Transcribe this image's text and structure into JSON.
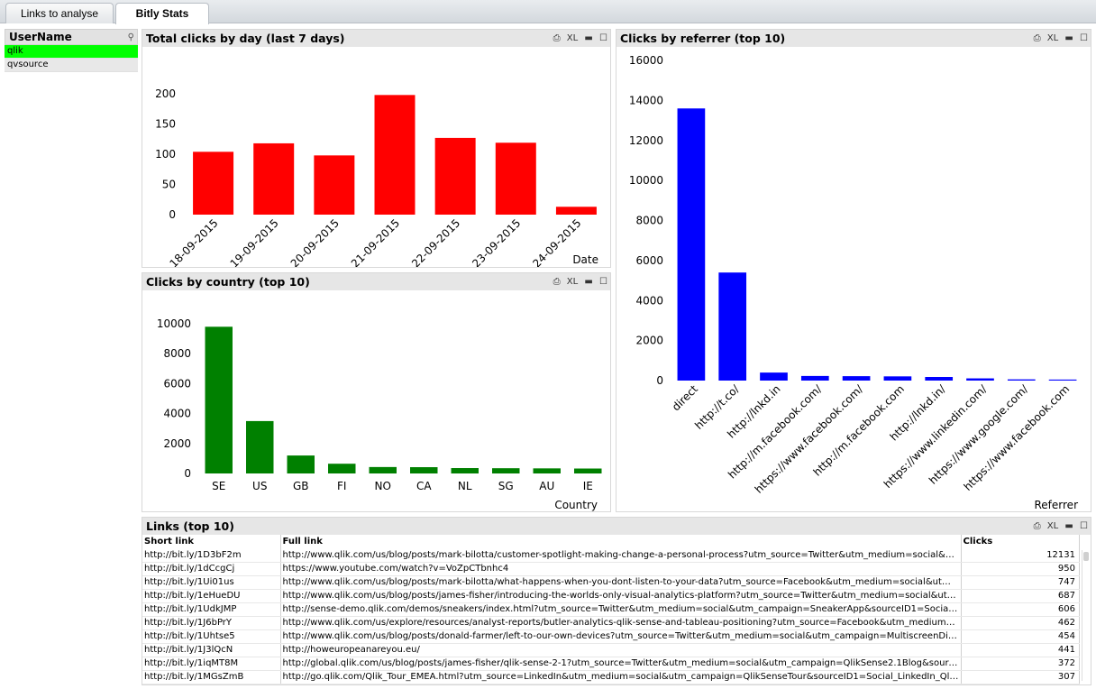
{
  "tabs": [
    "Links to analyse",
    "Bitly Stats"
  ],
  "listbox": {
    "title": "UserName",
    "items": [
      "qlik",
      "qvsource"
    ],
    "selected": "qlik"
  },
  "header_icons": {
    "print": "⎙",
    "xl": "XL",
    "minimize": "▬",
    "maximize": "☐"
  },
  "panels": {
    "clicks_by_day": {
      "title": "Total clicks by day (last 7 days)"
    },
    "clicks_by_country": {
      "title": "Clicks by country (top 10)"
    },
    "clicks_by_referrer": {
      "title": "Clicks by referrer (top 10)"
    },
    "links": {
      "title": "Links (top 10)"
    }
  },
  "chart_data": [
    {
      "id": "day",
      "type": "bar",
      "title": "Total clicks by day (last 7 days)",
      "xlabel": "Date",
      "ylabel": "",
      "color": "#ff0000",
      "categories": [
        "18-09-2015",
        "19-09-2015",
        "20-09-2015",
        "21-09-2015",
        "22-09-2015",
        "23-09-2015",
        "24-09-2015"
      ],
      "values": [
        104,
        118,
        98,
        198,
        127,
        119,
        13
      ],
      "ylim": [
        0,
        200
      ],
      "yticks": [
        0,
        50,
        100,
        150,
        200
      ],
      "grid": false
    },
    {
      "id": "country",
      "type": "bar",
      "title": "Clicks by country (top 10)",
      "xlabel": "Country",
      "ylabel": "",
      "color": "#008000",
      "categories": [
        "SE",
        "US",
        "GB",
        "FI",
        "NO",
        "CA",
        "NL",
        "SG",
        "AU",
        "IE"
      ],
      "values": [
        9800,
        3500,
        1200,
        650,
        430,
        420,
        360,
        350,
        340,
        330
      ],
      "ylim": [
        0,
        10000
      ],
      "yticks": [
        0,
        2000,
        4000,
        6000,
        8000,
        10000
      ],
      "grid": false
    },
    {
      "id": "referrer",
      "type": "bar",
      "title": "Clicks by referrer (top 10)",
      "xlabel": "Referrer",
      "ylabel": "",
      "color": "#0000ff",
      "categories": [
        "direct",
        "http://t.co/",
        "http://lnkd.in",
        "http://m.facebook.com/",
        "https://www.facebook.com/",
        "http://m.facebook.com",
        "http://lnkd.in/",
        "https://www.linkedin.com/",
        "https://www.google.com/",
        "https://www.facebook.com"
      ],
      "values": [
        13600,
        5400,
        400,
        230,
        220,
        210,
        180,
        110,
        60,
        50
      ],
      "ylim": [
        0,
        16000
      ],
      "yticks": [
        0,
        2000,
        4000,
        6000,
        8000,
        10000,
        12000,
        14000,
        16000
      ],
      "grid": false
    }
  ],
  "links_table": {
    "columns": [
      "Short link",
      "Full link",
      "Clicks"
    ],
    "rows": [
      [
        "http://bit.ly/1D3bF2m",
        "http://www.qlik.com/us/blog/posts/mark-bilotta/customer-spotlight-making-change-a-personal-process?utm_source=Twitter&utm_medium=social&ut…",
        "12131"
      ],
      [
        "http://bit.ly/1dCcgCj",
        "https://www.youtube.com/watch?v=VoZpCTbnhc4",
        "950"
      ],
      [
        "http://bit.ly/1Ui01us",
        "http://www.qlik.com/us/blog/posts/mark-bilotta/what-happens-when-you-dont-listen-to-your-data?utm_source=Facebook&utm_medium=social&utm_…",
        "747"
      ],
      [
        "http://bit.ly/1eHueDU",
        "http://www.qlik.com/us/blog/posts/james-fisher/introducing-the-worlds-only-visual-analytics-platform?utm_source=Twitter&utm_medium=social&utm_…",
        "687"
      ],
      [
        "http://bit.ly/1UdkJMP",
        "http://sense-demo.qlik.com/demos/sneakers/index.html?utm_source=Twitter&utm_medium=social&utm_campaign=SneakerApp&sourceID1=Social_T…",
        "606"
      ],
      [
        "http://bit.ly/1J6bPrY",
        "http://www.qlik.com/us/explore/resources/analyst-reports/butler-analytics-qlik-sense-and-tableau-positioning?utm_source=Facebook&utm_medium=so…",
        "462"
      ],
      [
        "http://bit.ly/1Uhtse5",
        "http://www.qlik.com/us/blog/posts/donald-farmer/left-to-our-own-devices?utm_source=Twitter&utm_medium=social&utm_campaign=MultiscreenDig…",
        "454"
      ],
      [
        "http://bit.ly/1J3lQcN",
        "http://howeuropeanareyou.eu/",
        "441"
      ],
      [
        "http://bit.ly/1iqMT8M",
        "http://global.qlik.com/us/blog/posts/james-fisher/qlik-sense-2-1?utm_source=Twitter&utm_medium=social&utm_campaign=QlikSense2.1Blog&sourceI…",
        "372"
      ],
      [
        "http://bit.ly/1MGsZmB",
        "http://go.qlik.com/Qlik_Tour_EMEA.html?utm_source=LinkedIn&utm_medium=social&utm_campaign=QlikSenseTour&sourceID1=Social_LinkedIn_Qlik…",
        "307"
      ]
    ]
  }
}
